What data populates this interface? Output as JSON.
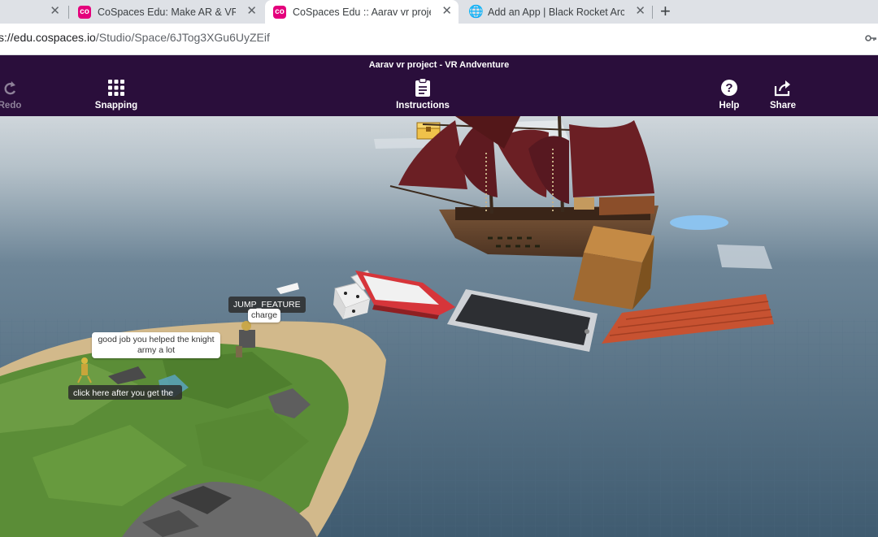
{
  "browser": {
    "tabs": [
      {
        "title": "",
        "close": "✕"
      },
      {
        "title": "CoSpaces Edu: Make AR & VR in",
        "close": "✕"
      },
      {
        "title": "CoSpaces Edu :: Aarav vr project",
        "close": "✕"
      },
      {
        "title": "Add an App | Black Rocket Arcad",
        "close": "✕"
      }
    ],
    "new_tab": "+",
    "url_host": "s://edu.cospaces.io",
    "url_path": "/Studio/Space/6JTog3XGu6UyZEif"
  },
  "app": {
    "title": "Aarav vr project - VR Andventure",
    "toolbar": {
      "redo": "Redo",
      "snapping": "Snapping",
      "instructions": "Instructions",
      "help": "Help",
      "share": "Share"
    }
  },
  "scene": {
    "labels": {
      "jump_feature": "JUMP_FEATURE",
      "charge": "charge",
      "knight_speech": "good job you helped the knight army a lot",
      "click_here": "click here after you get the"
    }
  },
  "colors": {
    "toolbar_bg": "#2a0e3b",
    "tab_strip_bg": "#dee1e6",
    "water": "#3f5b70",
    "sand": "#d2b98b",
    "grass": "#5b8d37",
    "ship_sails": "#6b1f24",
    "ship_hull": "#6b4a32",
    "bridge": "#c75231"
  },
  "icons": {
    "redo": "redo-icon",
    "snapping": "grid-icon",
    "instructions": "clipboard-icon",
    "help": "help-icon",
    "share": "share-icon",
    "tab_favicon": "cospaces-favicon-icon",
    "globe": "globe-icon"
  }
}
